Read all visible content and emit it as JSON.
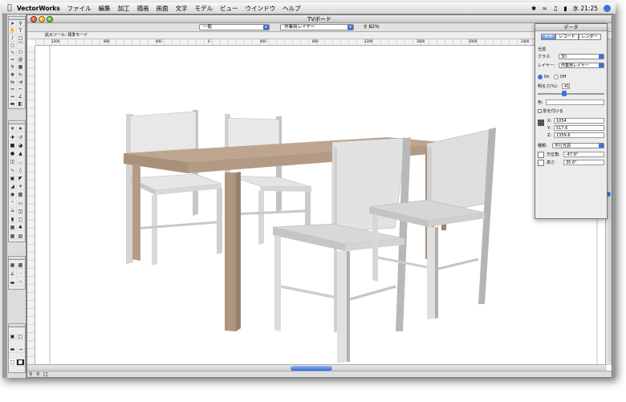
{
  "menubar": {
    "app_name": "VectorWorks",
    "menus": [
      "ファイル",
      "編集",
      "加工",
      "描画",
      "画面",
      "文字",
      "モデル",
      "ビュー",
      "ウインドウ",
      "ヘルプ"
    ],
    "clock": "水 21:25"
  },
  "document": {
    "title": "TVボード",
    "class_popup": "一般",
    "layer_popup": "作業用レイヤー",
    "zoom": "82%",
    "mode_text": "拡大ツール: 標準モード"
  },
  "ruler": {
    "labels": [
      "1200",
      "800",
      "400",
      "0",
      "400",
      "800",
      "1200",
      "1600",
      "2000",
      "2400",
      "2800"
    ]
  },
  "data_palette": {
    "title": "データ",
    "tabs": [
      "形状",
      "レコード",
      "レンダー"
    ],
    "section": "光源",
    "class_label": "クラス:",
    "class_value": "3D",
    "layer_label": "レイヤー:",
    "layer_value": "作業用レイヤー",
    "on_label": "On",
    "off_label": "Off",
    "brightness_label": "明るさ(%):",
    "brightness_value": "41",
    "color_label": "色:",
    "shadow_label": "影を付ける",
    "x_value": "1054",
    "y_value": "517.6",
    "z_value": "1359.6",
    "kind_label": "種類:",
    "kind_value": "平行光源",
    "azimuth_label": "方位角:",
    "azimuth_value": "-47.6°",
    "elevation_label": "高さ:",
    "elevation_value": "35.6°"
  },
  "colors": {
    "table_top": "#bda58f",
    "table_side": "#a98e78",
    "chair_light": "#e6e6e6",
    "chair_dark": "#b8b8b8",
    "accent": "#3a73d8"
  }
}
